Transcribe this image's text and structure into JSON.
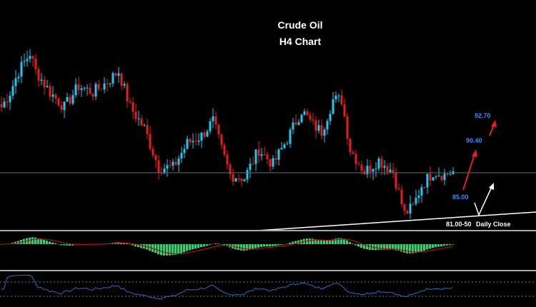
{
  "chart_data": {
    "type": "candlestick",
    "title": "Crude Oil",
    "subtitle": "H4 Chart",
    "price_path_keypoints": [
      {
        "i": 0,
        "p": 93.5
      },
      {
        "i": 3,
        "p": 94.9
      },
      {
        "i": 6,
        "p": 96.9
      },
      {
        "i": 10,
        "p": 98.6
      },
      {
        "i": 12,
        "p": 96.9
      },
      {
        "i": 17,
        "p": 94.9
      },
      {
        "i": 22,
        "p": 93.5
      },
      {
        "i": 27,
        "p": 95.5
      },
      {
        "i": 32,
        "p": 94.9
      },
      {
        "i": 37,
        "p": 95.9
      },
      {
        "i": 41,
        "p": 96.9
      },
      {
        "i": 45,
        "p": 93.5
      },
      {
        "i": 50,
        "p": 91.5
      },
      {
        "i": 55,
        "p": 87.8
      },
      {
        "i": 60,
        "p": 87.8
      },
      {
        "i": 65,
        "p": 90.1
      },
      {
        "i": 70,
        "p": 90.8
      },
      {
        "i": 74,
        "p": 92.2
      },
      {
        "i": 77,
        "p": 89.5
      },
      {
        "i": 80,
        "p": 87.1
      },
      {
        "i": 85,
        "p": 86.8
      },
      {
        "i": 90,
        "p": 89.5
      },
      {
        "i": 95,
        "p": 88.1
      },
      {
        "i": 100,
        "p": 90.5
      },
      {
        "i": 105,
        "p": 93.2
      },
      {
        "i": 109,
        "p": 91.8
      },
      {
        "i": 112,
        "p": 91.2
      },
      {
        "i": 116,
        "p": 94.2
      },
      {
        "i": 119,
        "p": 94.2
      },
      {
        "i": 122,
        "p": 89.5
      },
      {
        "i": 127,
        "p": 87.4
      },
      {
        "i": 132,
        "p": 88.5
      },
      {
        "i": 137,
        "p": 87.4
      },
      {
        "i": 141,
        "p": 83.4
      },
      {
        "i": 144,
        "p": 84.1
      },
      {
        "i": 147,
        "p": 86.1
      },
      {
        "i": 151,
        "p": 87.4
      },
      {
        "i": 155,
        "p": 87.1
      },
      {
        "i": 158,
        "p": 87.4
      }
    ],
    "horizontal_level": 87.3,
    "annotations": {
      "target_2": "92.70",
      "target_1": "90.40",
      "pivot": "85.00",
      "support": "81.00-50",
      "support_note": "Daily Close"
    },
    "indicators": [
      "MACD histogram with signal line",
      "RSI"
    ],
    "colors": {
      "up": "#1ec8f0",
      "down": "#e81c1c",
      "macd": "#3cc878",
      "signal": "#b01010",
      "rsi": "#2a6cc8",
      "label": "#2f8cff"
    }
  }
}
